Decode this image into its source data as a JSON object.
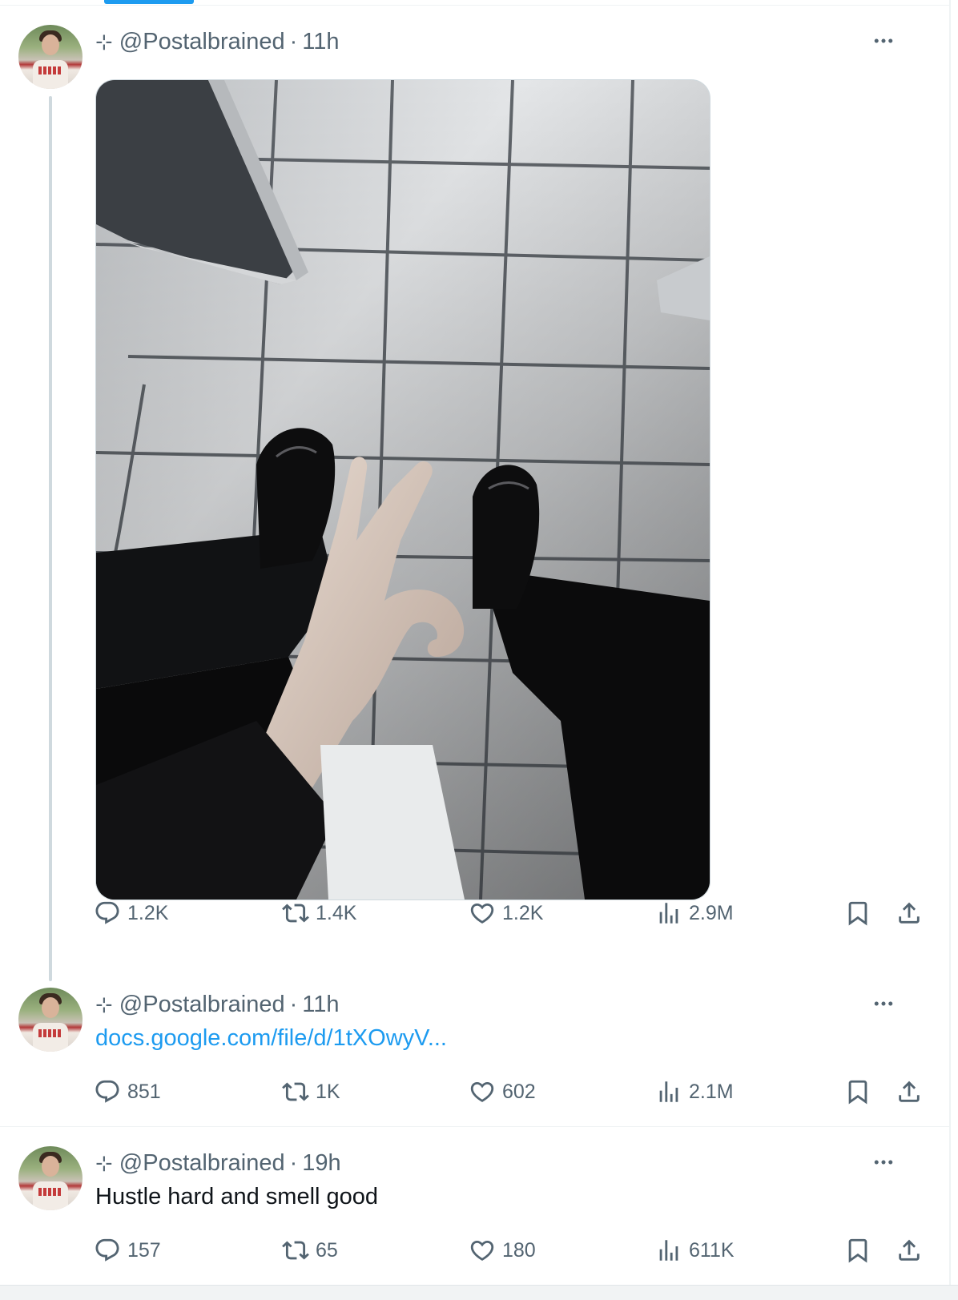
{
  "tweets": [
    {
      "handle": "@Postalbrained",
      "time": "11h",
      "actions": {
        "replies": "1.2K",
        "reposts": "1.4K",
        "likes": "1.2K",
        "views": "2.9M"
      }
    },
    {
      "handle": "@Postalbrained",
      "time": "11h",
      "link": "docs.google.com/file/d/1tXOwyV...",
      "actions": {
        "replies": "851",
        "reposts": "1K",
        "likes": "602",
        "views": "2.1M"
      }
    },
    {
      "handle": "@Postalbrained",
      "time": "19h",
      "text": "Hustle hard and smell good",
      "actions": {
        "replies": "157",
        "reposts": "65",
        "likes": "180",
        "views": "611K"
      }
    }
  ],
  "header_prefix": "⊹",
  "separator": "·",
  "icons": {
    "reply": "reply-icon",
    "repost": "repost-icon",
    "like": "like-icon",
    "views": "views-icon",
    "bookmark": "bookmark-icon",
    "share": "share-icon",
    "more": "more-icon"
  },
  "colors": {
    "link": "#1d9bf0",
    "muted": "#536471",
    "thread_line": "#cfd9de"
  }
}
